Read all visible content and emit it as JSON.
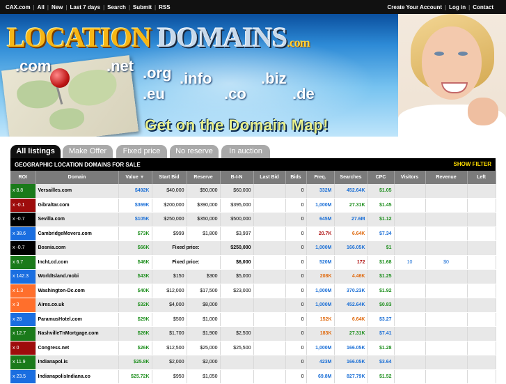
{
  "topbar": {
    "brand": "CAX.com",
    "links": [
      "All",
      "New",
      "Last 7 days",
      "Search",
      "Submit",
      "RSS"
    ],
    "right_links": [
      "Create Your Account",
      "Log in",
      "Contact"
    ]
  },
  "banner": {
    "logo_word1": "LOCATION",
    "logo_word2": "DOMAINS",
    "logo_tld": ".com",
    "tlds": [
      ".com",
      ".net",
      ".org",
      ".info",
      ".biz",
      ".eu",
      ".co",
      ".de"
    ],
    "tagline": "Get on the Domain Map!"
  },
  "tabs": [
    "All listings",
    "Make Offer",
    "Fixed price",
    "No reserve",
    "In auction"
  ],
  "list_header": {
    "title": "GEOGRAPHIC LOCATION DOMAINS FOR SALE",
    "filter_label": "SHOW FILTER"
  },
  "columns": [
    "ROI",
    "Domain",
    "Value",
    "Start Bid",
    "Reserve",
    "B-I-N",
    "Last Bid",
    "Bids",
    "Freq.",
    "Searches",
    "CPC",
    "Visitors",
    "Revenue",
    "Left"
  ],
  "colors": {
    "roi_green": "#1a7a1a",
    "roi_red": "#9e0c0c",
    "roi_black": "#000000",
    "roi_blue": "#1a6ee0",
    "roi_orange": "#ff6f2c"
  },
  "rows": [
    {
      "roi": "x 8.8",
      "roi_color": "#1a7a1a",
      "domain": "Versailles.com",
      "value": "$492K",
      "value_color": "blue",
      "start_bid": "$40,000",
      "reserve": "$50,000",
      "bin": "$60,000",
      "last_bid": "",
      "bids": "0",
      "freq": "332M",
      "freq_color": "blue",
      "searches": "452.64K",
      "searches_color": "blue",
      "cpc": "$1.05",
      "cpc_color": "green",
      "visitors": "",
      "revenue": "",
      "left": ""
    },
    {
      "roi": "x -0.1",
      "roi_color": "#9e0c0c",
      "domain": "Gibraltar.com",
      "value": "$369K",
      "value_color": "blue",
      "start_bid": "$200,000",
      "reserve": "$390,000",
      "bin": "$395,000",
      "last_bid": "",
      "bids": "0",
      "freq": "1,000M",
      "freq_color": "blue",
      "searches": "27.31K",
      "searches_color": "green",
      "cpc": "$1.45",
      "cpc_color": "green",
      "visitors": "",
      "revenue": "",
      "left": ""
    },
    {
      "roi": "x -0.7",
      "roi_color": "#000000",
      "domain": "Sevilla.com",
      "value": "$105K",
      "value_color": "blue",
      "start_bid": "$250,000",
      "reserve": "$350,000",
      "bin": "$500,000",
      "last_bid": "",
      "bids": "0",
      "freq": "645M",
      "freq_color": "blue",
      "searches": "27.6M",
      "searches_color": "blue",
      "cpc": "$1.12",
      "cpc_color": "green",
      "visitors": "",
      "revenue": "",
      "left": ""
    },
    {
      "roi": "x 38.6",
      "roi_color": "#1a6ee0",
      "domain": "CambridgeMovers.com",
      "value": "$73K",
      "value_color": "green",
      "start_bid": "$999",
      "reserve": "$1,800",
      "bin": "$3,997",
      "last_bid": "",
      "bids": "0",
      "freq": "20.7K",
      "freq_color": "red",
      "searches": "6.64K",
      "searches_color": "orange",
      "cpc": "$7.34",
      "cpc_color": "blue",
      "visitors": "",
      "revenue": "",
      "left": ""
    },
    {
      "roi": "x -0.7",
      "roi_color": "#000000",
      "domain": "Bosnia.com",
      "value": "$66K",
      "value_color": "green",
      "fixed_label": "Fixed price:",
      "bin": "$250,000",
      "last_bid": "",
      "bids": "0",
      "freq": "1,000M",
      "freq_color": "blue",
      "searches": "166.05K",
      "searches_color": "blue",
      "cpc": "$1",
      "cpc_color": "green",
      "visitors": "",
      "revenue": "",
      "left": ""
    },
    {
      "roi": "x 6.7",
      "roi_color": "#1a7a1a",
      "domain": "InchLcd.com",
      "value": "$46K",
      "value_color": "green",
      "fixed_label": "Fixed price:",
      "bin": "$6,000",
      "last_bid": "",
      "bids": "0",
      "freq": "520M",
      "freq_color": "blue",
      "searches": "172",
      "searches_color": "red",
      "cpc": "$1.68",
      "cpc_color": "green",
      "visitors": "10",
      "revenue": "$0",
      "left": ""
    },
    {
      "roi": "x 142.3",
      "roi_color": "#1a6ee0",
      "domain": "WorldIsland.mobi",
      "value": "$43K",
      "value_color": "green",
      "start_bid": "$150",
      "reserve": "$300",
      "bin": "$5,000",
      "last_bid": "",
      "bids": "0",
      "freq": "208K",
      "freq_color": "orange",
      "searches": "4.46K",
      "searches_color": "orange",
      "cpc": "$1.25",
      "cpc_color": "green",
      "visitors": "",
      "revenue": "",
      "left": ""
    },
    {
      "roi": "x 1.3",
      "roi_color": "#ff6f2c",
      "domain": "Washington-Dc.com",
      "value": "$40K",
      "value_color": "green",
      "start_bid": "$12,000",
      "reserve": "$17,500",
      "bin": "$23,000",
      "last_bid": "",
      "bids": "0",
      "freq": "1,000M",
      "freq_color": "blue",
      "searches": "370.23K",
      "searches_color": "blue",
      "cpc": "$1.92",
      "cpc_color": "green",
      "visitors": "",
      "revenue": "",
      "left": ""
    },
    {
      "roi": "x 3",
      "roi_color": "#ff6f2c",
      "domain": "Aires.co.uk",
      "value": "$32K",
      "value_color": "green",
      "start_bid": "$4,000",
      "reserve": "$8,000",
      "bin": "",
      "last_bid": "",
      "bids": "0",
      "freq": "1,000M",
      "freq_color": "blue",
      "searches": "452.64K",
      "searches_color": "blue",
      "cpc": "$0.83",
      "cpc_color": "green",
      "visitors": "",
      "revenue": "",
      "left": ""
    },
    {
      "roi": "x 28",
      "roi_color": "#1a6ee0",
      "domain": "ParamusHotel.com",
      "value": "$29K",
      "value_color": "green",
      "start_bid": "$500",
      "reserve": "$1,000",
      "bin": "",
      "last_bid": "",
      "bids": "0",
      "freq": "152K",
      "freq_color": "orange",
      "searches": "6.64K",
      "searches_color": "orange",
      "cpc": "$3.27",
      "cpc_color": "blue",
      "visitors": "",
      "revenue": "",
      "left": ""
    },
    {
      "roi": "x 12.7",
      "roi_color": "#1a7a1a",
      "domain": "NashvilleTnMortgage.com",
      "value": "$26K",
      "value_color": "green",
      "start_bid": "$1,700",
      "reserve": "$1,900",
      "bin": "$2,500",
      "last_bid": "",
      "bids": "0",
      "freq": "183K",
      "freq_color": "orange",
      "searches": "27.31K",
      "searches_color": "green",
      "cpc": "$7.41",
      "cpc_color": "blue",
      "visitors": "",
      "revenue": "",
      "left": ""
    },
    {
      "roi": "x 0",
      "roi_color": "#9e0c0c",
      "domain": "Congress.net",
      "value": "$26K",
      "value_color": "green",
      "start_bid": "$12,500",
      "reserve": "$25,000",
      "bin": "$25,500",
      "last_bid": "",
      "bids": "0",
      "freq": "1,000M",
      "freq_color": "blue",
      "searches": "166.05K",
      "searches_color": "blue",
      "cpc": "$1.28",
      "cpc_color": "green",
      "visitors": "",
      "revenue": "",
      "left": ""
    },
    {
      "roi": "x 11.9",
      "roi_color": "#1a7a1a",
      "domain": "Indianapol.is",
      "value": "$25.8K",
      "value_color": "green",
      "start_bid": "$2,000",
      "reserve": "$2,000",
      "bin": "",
      "last_bid": "",
      "bids": "0",
      "freq": "423M",
      "freq_color": "blue",
      "searches": "166.05K",
      "searches_color": "blue",
      "cpc": "$3.64",
      "cpc_color": "blue",
      "visitors": "",
      "revenue": "",
      "left": ""
    },
    {
      "roi": "x 23.5",
      "roi_color": "#1a6ee0",
      "domain": "IndianapolisIndiana.co",
      "value": "$25.72K",
      "value_color": "green",
      "start_bid": "$950",
      "reserve": "$1,050",
      "bin": "",
      "last_bid": "",
      "bids": "0",
      "freq": "69.8M",
      "freq_color": "blue",
      "searches": "827.79K",
      "searches_color": "blue",
      "cpc": "$1.52",
      "cpc_color": "green",
      "visitors": "",
      "revenue": "",
      "left": ""
    }
  ]
}
